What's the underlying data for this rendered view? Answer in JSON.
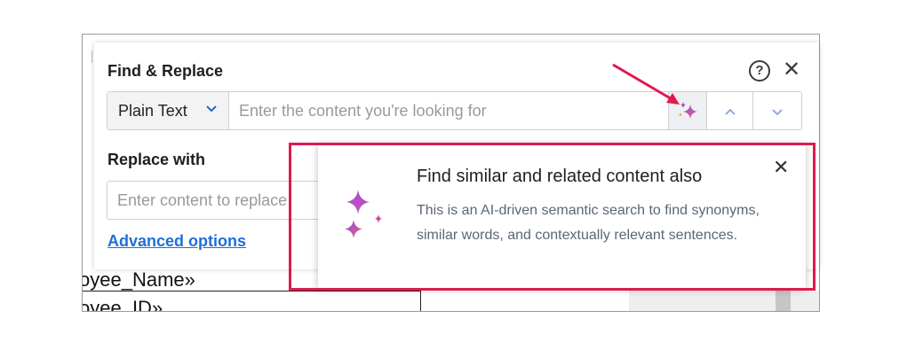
{
  "document": {
    "row1_text": "oyee_Name»",
    "row2_text": "oyee_ID»"
  },
  "find_replace": {
    "title": "Find & Replace",
    "help_icon": "question-circle-icon",
    "close_icon": "close-icon",
    "mode_selected": "Plain Text",
    "search_placeholder": "Enter the content you're looking for",
    "ai_button_icon": "sparkle-icon",
    "prev_icon": "chevron-up-icon",
    "next_icon": "chevron-down-icon",
    "replace_label": "Replace with",
    "replace_placeholder": "Enter content to replace",
    "advanced_options": "Advanced options"
  },
  "tooltip": {
    "title": "Find similar and related content also",
    "body": "This is an AI-driven semantic search to find synonyms, similar words, and contextually relevant sentences.",
    "icon": "sparkle-icon",
    "close_icon": "close-icon"
  },
  "colors": {
    "accent_link": "#1e6fd9",
    "annotation": "#e0194f",
    "sparkle_purple": "#9b4bd0",
    "sparkle_pink": "#e0508a"
  }
}
